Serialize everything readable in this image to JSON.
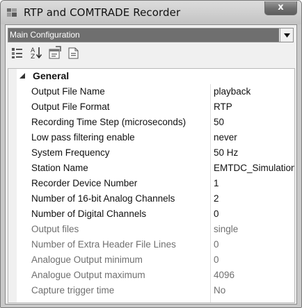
{
  "window": {
    "title": "RTP and COMTRADE Recorder",
    "close_glyph": "x"
  },
  "combo": {
    "value": "Main Configuration"
  },
  "toolbar": {
    "buttons": [
      "categorized-icon",
      "alphabetical-icon",
      "property-pages-icon",
      "description-icon"
    ]
  },
  "grid": {
    "category": "General",
    "properties": [
      {
        "name": "Output File Name",
        "value": "playback",
        "readonly": false
      },
      {
        "name": "Output File Format",
        "value": "RTP",
        "readonly": false
      },
      {
        "name": "Recording Time Step (microseconds)",
        "value": "50",
        "readonly": false
      },
      {
        "name": "Low pass filtering enable",
        "value": "never",
        "readonly": false
      },
      {
        "name": "System Frequency",
        "value": "50 Hz",
        "readonly": false
      },
      {
        "name": "Station Name",
        "value": "EMTDC_Simulation",
        "readonly": false
      },
      {
        "name": "Recorder Device Number",
        "value": "1",
        "readonly": false
      },
      {
        "name": "Number of 16-bit Analog Channels",
        "value": "2",
        "readonly": false
      },
      {
        "name": "Number of Digital Channels",
        "value": "0",
        "readonly": false
      },
      {
        "name": "Output files",
        "value": "single",
        "readonly": true
      },
      {
        "name": "Number of Extra Header File Lines",
        "value": "0",
        "readonly": true
      },
      {
        "name": "Analogue Output minimum",
        "value": "0",
        "readonly": true
      },
      {
        "name": "Analogue Output maximum",
        "value": "4096",
        "readonly": true
      },
      {
        "name": "Capture trigger time",
        "value": "No",
        "readonly": true
      }
    ]
  }
}
